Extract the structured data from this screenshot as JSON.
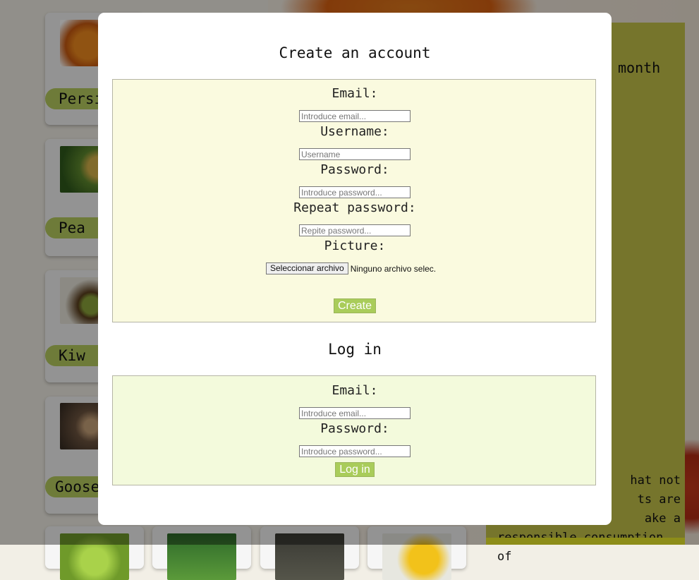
{
  "background": {
    "cards": [
      {
        "name": "Persimmon",
        "thumb": "persimmon-photo"
      },
      {
        "name": "Pear",
        "thumb": "pear-photo"
      },
      {
        "name": "Kiwi",
        "thumb": "kiwi-photo"
      },
      {
        "name": "Gooseberry",
        "thumb": "gooseberry-photo"
      }
    ],
    "card_peek": {
      "visible_names": [
        "Persi",
        "Pea",
        "Kiw",
        "Gooseb"
      ]
    },
    "side_panel": {
      "month_text": "month",
      "paragraph_lines": [
        "hat not",
        "ts are",
        "ake a",
        "responsible consumption of"
      ]
    }
  },
  "modal": {
    "create": {
      "title": "Create an account",
      "email_label": "Email:",
      "email_placeholder": "Introduce email...",
      "username_label": "Username:",
      "username_placeholder": "Username",
      "password_label": "Password:",
      "password_placeholder": "Introduce password...",
      "repeat_label": "Repeat password:",
      "repeat_placeholder": "Repite password...",
      "picture_label": "Picture:",
      "file_button": "Seleccionar archivo",
      "file_status": "Ninguno archivo selec.",
      "submit": "Create"
    },
    "login": {
      "title": "Log in",
      "email_label": "Email:",
      "email_placeholder": "Introduce email...",
      "password_label": "Password:",
      "password_placeholder": "Introduce password...",
      "submit": "Log in"
    }
  },
  "colors": {
    "accent_green": "#a9cc5a",
    "create_box_bg": "#fafadf",
    "login_box_bg": "#f3fadc",
    "side_panel": "#c5c34a",
    "overlay": "rgba(0,0,0,0.4)"
  }
}
